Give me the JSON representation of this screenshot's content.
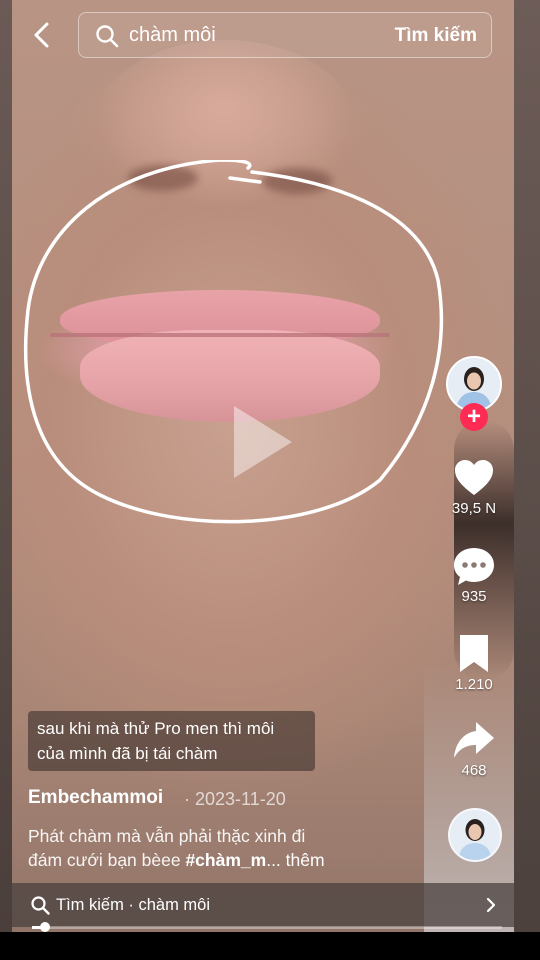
{
  "search": {
    "query": "chàm môi",
    "button_label": "Tìm kiếm"
  },
  "overlay_caption": {
    "line1": "sau khi mà thử Pro men thì môi",
    "line2": "của mình đã bị tái chàm"
  },
  "actions": {
    "likes": "39,5 N",
    "comments": "935",
    "saves": "1.210",
    "shares": "468"
  },
  "video": {
    "author": "Embechammoi",
    "date_sep": " · ",
    "date": "2023-11-20",
    "desc_line1": "Phát chàm mà vẫn phải thặc xinh đi",
    "desc_line2_text": "đám cưới bạn bèee ",
    "hashtag": "#chàm_m",
    "more": "... thêm",
    "progress": 0.02
  },
  "bottom_bar": {
    "label": "Tìm kiếm · chàm môi"
  },
  "colors": {
    "follow_red": "#fe2c55",
    "text": "#ffffff"
  },
  "icons": [
    "back-arrow-icon",
    "search-icon",
    "play-icon",
    "heart-icon",
    "comment-icon",
    "bookmark-icon",
    "share-icon",
    "chevron-right-icon"
  ]
}
